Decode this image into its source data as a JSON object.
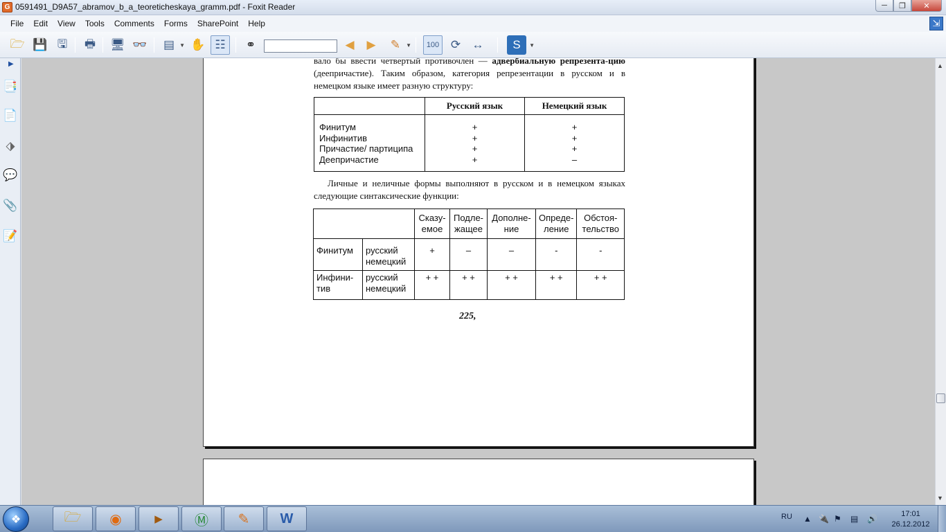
{
  "window": {
    "title": "0591491_D9A57_abramov_b_a_teoreticheskaya_gramm.pdf - Foxit Reader",
    "app_icon_text": "G"
  },
  "menu": {
    "items": [
      "File",
      "Edit",
      "View",
      "Tools",
      "Comments",
      "Forms",
      "SharePoint",
      "Help"
    ]
  },
  "find": {
    "value": ""
  },
  "document": {
    "para1_part1": "вало бы ввести четвертый противочлен — ",
    "para1_bold": "адвербиальную репрезента-цию",
    "para1_part2": " (деепричастие). Таким образом, категория репрезентации в русском и в немецком языке имеет разную структуру:",
    "table1": {
      "headers": [
        "",
        "Русский язык",
        "Немецкий язык"
      ],
      "forms": [
        "Финитум",
        "Инфинитив",
        "Причастие/ партиципа",
        "Деепричастие"
      ],
      "russian": [
        "+",
        "+",
        "+",
        "+"
      ],
      "german": [
        "+",
        "+",
        "+",
        "–"
      ]
    },
    "para2": "Личные и неличные формы выполняют в русском и в немецком языках следующие синтаксические функции:",
    "table2": {
      "headers": [
        "Сказу-емое",
        "Подле-жащее",
        "Дополне-ние",
        "Опреде-ление",
        "Обстоя-тельство"
      ],
      "rows": [
        {
          "form": "Финитум",
          "langs": "русский немецкий",
          "values": [
            "+",
            "–",
            "–",
            "-",
            "-"
          ]
        },
        {
          "form": "Инфини-тив",
          "langs": "русский немецкий",
          "values": [
            "+ +",
            "+ +",
            "+ +",
            "+ +",
            "+ +"
          ]
        }
      ]
    },
    "page_number": "225,"
  },
  "taskbar": {
    "language": "RU",
    "time": "17:01",
    "date": "26.12.2012"
  }
}
